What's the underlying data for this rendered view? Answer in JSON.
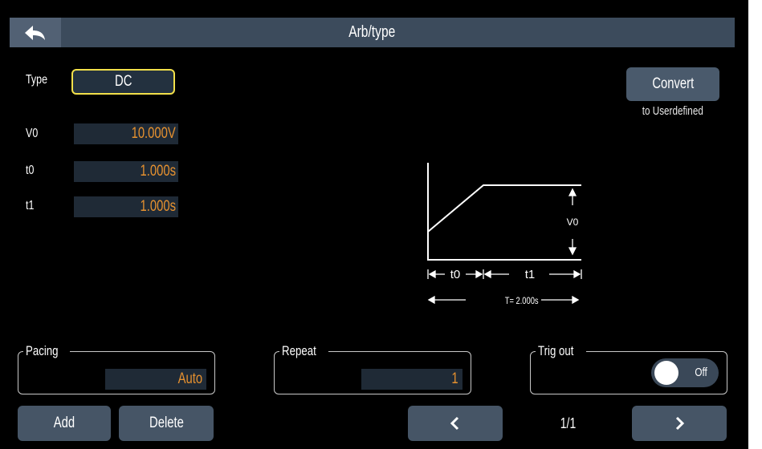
{
  "header": {
    "title": "Arb/type",
    "back_icon": "back-arrow-icon"
  },
  "params": {
    "type_label": "Type",
    "type_value": "DC",
    "v0_label": "V0",
    "v0_value": "10.000V",
    "t0_label": "t0",
    "t0_value": "1.000s",
    "t1_label": "t1",
    "t1_value": "1.000s"
  },
  "convert": {
    "label": "Convert",
    "sublabel": "to Userdefined"
  },
  "diagram": {
    "v0_label": "V0",
    "t0_label": "t0",
    "t1_label": "t1",
    "total_label": "T= 2.000s"
  },
  "pacing": {
    "label": "Pacing",
    "value": "Auto"
  },
  "repeat": {
    "label": "Repeat",
    "value": "1"
  },
  "trig_out": {
    "label": "Trig out",
    "state": "Off"
  },
  "footer": {
    "add_label": "Add",
    "delete_label": "Delete",
    "prev_icon": "chevron-left-icon",
    "next_icon": "chevron-right-icon",
    "page": "1/1"
  },
  "colors": {
    "background": "#000000",
    "title_bar": "#3c4b5c",
    "button": "#465566",
    "value_text": "#e6912f",
    "value_box": "#1f2a36",
    "type_border": "#f2e04a"
  }
}
